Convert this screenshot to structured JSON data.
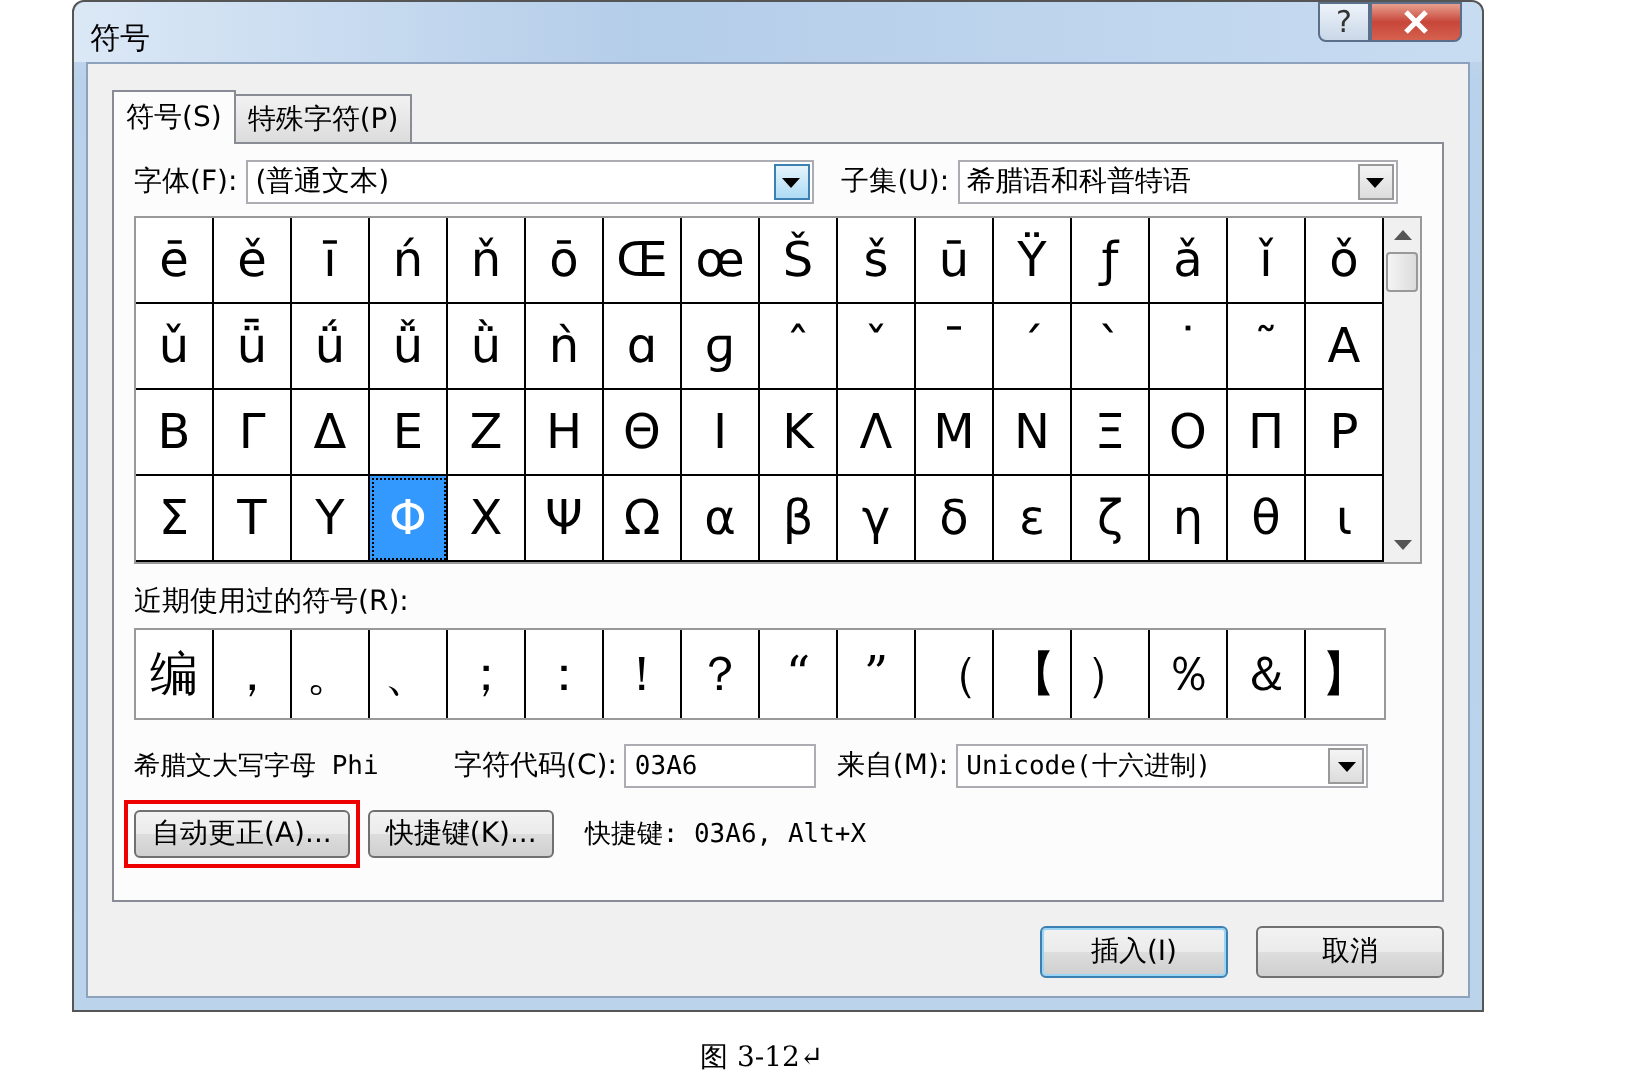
{
  "window": {
    "title": "符号",
    "help": "?"
  },
  "tabs": [
    {
      "label": "符号(S)",
      "selected": true
    },
    {
      "label": "特殊字符(P)",
      "selected": false
    }
  ],
  "font": {
    "label": "字体(F):",
    "value": "(普通文本)"
  },
  "subset": {
    "label": "子集(U):",
    "value": "希腊语和科普特语"
  },
  "symbols": [
    {
      "char": "ē",
      "selected": false
    },
    {
      "char": "ě",
      "selected": false
    },
    {
      "char": "ī",
      "selected": false
    },
    {
      "char": "ń",
      "selected": false
    },
    {
      "char": "ň",
      "selected": false
    },
    {
      "char": "ō",
      "selected": false
    },
    {
      "char": "Œ",
      "selected": false
    },
    {
      "char": "œ",
      "selected": false
    },
    {
      "char": "Š",
      "selected": false
    },
    {
      "char": "š",
      "selected": false
    },
    {
      "char": "ū",
      "selected": false
    },
    {
      "char": "Ÿ",
      "selected": false
    },
    {
      "char": "ƒ",
      "selected": false
    },
    {
      "char": "ǎ",
      "selected": false
    },
    {
      "char": "ǐ",
      "selected": false
    },
    {
      "char": "ǒ",
      "selected": false
    },
    {
      "char": "ǔ",
      "selected": false
    },
    {
      "char": "ǖ",
      "selected": false
    },
    {
      "char": "ǘ",
      "selected": false
    },
    {
      "char": "ǚ",
      "selected": false
    },
    {
      "char": "ǜ",
      "selected": false
    },
    {
      "char": "ǹ",
      "selected": false
    },
    {
      "char": "ɑ",
      "selected": false
    },
    {
      "char": "ɡ",
      "selected": false
    },
    {
      "char": "ˆ",
      "selected": false
    },
    {
      "char": "ˇ",
      "selected": false
    },
    {
      "char": "ˉ",
      "selected": false
    },
    {
      "char": "ˊ",
      "selected": false
    },
    {
      "char": "ˋ",
      "selected": false
    },
    {
      "char": "˙",
      "selected": false
    },
    {
      "char": "˜",
      "selected": false
    },
    {
      "char": "Α",
      "selected": false
    },
    {
      "char": "Β",
      "selected": false
    },
    {
      "char": "Γ",
      "selected": false
    },
    {
      "char": "Δ",
      "selected": false
    },
    {
      "char": "Ε",
      "selected": false
    },
    {
      "char": "Ζ",
      "selected": false
    },
    {
      "char": "Η",
      "selected": false
    },
    {
      "char": "Θ",
      "selected": false
    },
    {
      "char": "Ι",
      "selected": false
    },
    {
      "char": "Κ",
      "selected": false
    },
    {
      "char": "Λ",
      "selected": false
    },
    {
      "char": "Μ",
      "selected": false
    },
    {
      "char": "Ν",
      "selected": false
    },
    {
      "char": "Ξ",
      "selected": false
    },
    {
      "char": "Ο",
      "selected": false
    },
    {
      "char": "Π",
      "selected": false
    },
    {
      "char": "Ρ",
      "selected": false
    },
    {
      "char": "Σ",
      "selected": false
    },
    {
      "char": "Τ",
      "selected": false
    },
    {
      "char": "Υ",
      "selected": false
    },
    {
      "char": "Φ",
      "selected": true
    },
    {
      "char": "Χ",
      "selected": false
    },
    {
      "char": "Ψ",
      "selected": false
    },
    {
      "char": "Ω",
      "selected": false
    },
    {
      "char": "α",
      "selected": false
    },
    {
      "char": "β",
      "selected": false
    },
    {
      "char": "γ",
      "selected": false
    },
    {
      "char": "δ",
      "selected": false
    },
    {
      "char": "ε",
      "selected": false
    },
    {
      "char": "ζ",
      "selected": false
    },
    {
      "char": "η",
      "selected": false
    },
    {
      "char": "θ",
      "selected": false
    },
    {
      "char": "ι",
      "selected": false
    }
  ],
  "recent": {
    "label": "近期使用过的符号(R):",
    "symbols": [
      "编",
      "，",
      "。",
      "、",
      "；",
      "：",
      "！",
      "？",
      "“",
      "”",
      "（",
      "【",
      "）",
      "％",
      "＆",
      "】"
    ]
  },
  "info": {
    "name": "希腊文大写字母 Phi",
    "code_label": "字符代码(C):",
    "code": "03A6",
    "from_label": "来自(M):",
    "from": "Unicode(十六进制)"
  },
  "buttons": [
    {
      "label": "自动更正(A)...",
      "highlighted": true
    },
    {
      "label": "快捷键(K)...",
      "highlighted": false
    }
  ],
  "shortcut": "快捷键: 03A6, Alt+X",
  "actions": [
    "插入(I)",
    "取消"
  ],
  "caption": "图 3-12↵"
}
